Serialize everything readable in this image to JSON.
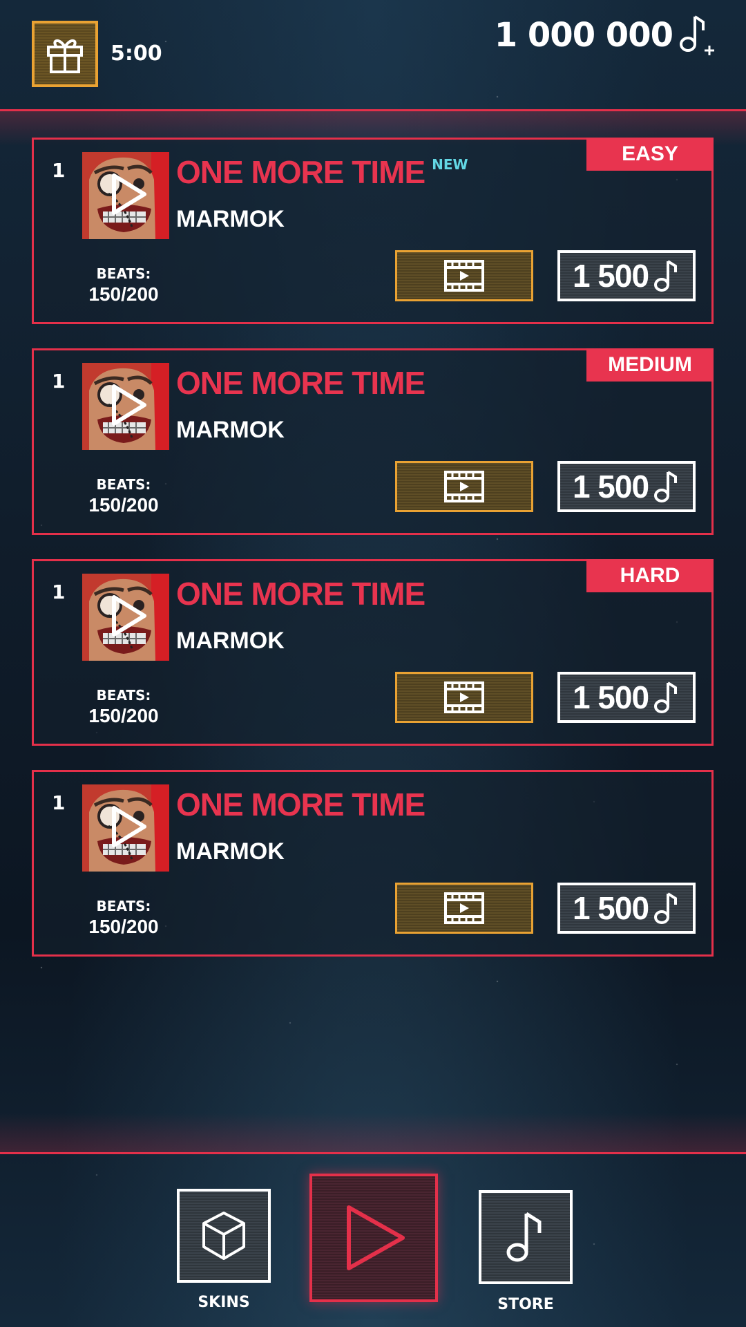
{
  "header": {
    "timer": "5:00",
    "coins": "1 000 000"
  },
  "songs": [
    {
      "rank": "1",
      "title": "ONE MORE TIME",
      "badge": "NEW",
      "artist": "MARMOK",
      "beats_label": "BEATS:",
      "beats": "150/200",
      "difficulty": "EASY",
      "price": "1 500"
    },
    {
      "rank": "1",
      "title": "ONE MORE TIME",
      "badge": "",
      "artist": "MARMOK",
      "beats_label": "BEATS:",
      "beats": "150/200",
      "difficulty": "MEDIUM",
      "price": "1 500"
    },
    {
      "rank": "1",
      "title": "ONE MORE TIME",
      "badge": "",
      "artist": "MARMOK",
      "beats_label": "BEATS:",
      "beats": "150/200",
      "difficulty": "HARD",
      "price": "1 500"
    },
    {
      "rank": "1",
      "title": "ONE MORE TIME",
      "badge": "",
      "artist": "MARMOK",
      "beats_label": "BEATS:",
      "beats": "150/200",
      "difficulty": "",
      "price": "1 500"
    }
  ],
  "nav": {
    "skins_label": "SKINS",
    "store_label": "STORE"
  },
  "icons": {
    "gift": "gift-icon",
    "note": "music-note-icon",
    "video": "film-play-icon",
    "cube": "cube-icon",
    "play": "play-icon"
  },
  "colors": {
    "accent_red": "#e8344f",
    "accent_gold": "#e9a233",
    "new_badge": "#63d7e4"
  }
}
